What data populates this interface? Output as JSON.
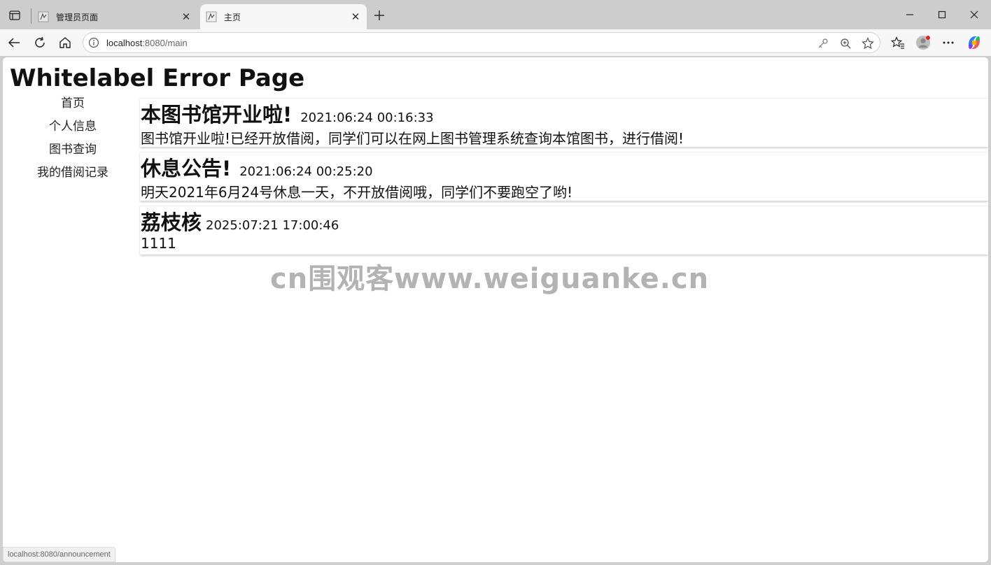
{
  "tabs": [
    {
      "title": "管理员页面",
      "active": false
    },
    {
      "title": "主页",
      "active": true
    }
  ],
  "addressbar": {
    "host": "localhost",
    "path": ":8080/main"
  },
  "page": {
    "heading": "Whitelabel Error Page"
  },
  "nav": {
    "items": [
      "首页",
      "个人信息",
      "图书查询",
      "我的借阅记录"
    ]
  },
  "notices": [
    {
      "title": "本图书馆开业啦!",
      "time": "2021:06:24 00:16:33",
      "body": "图书馆开业啦!已经开放借阅，同学们可以在网上图书管理系统查询本馆图书，进行借阅!"
    },
    {
      "title": "休息公告!",
      "time": "2021:06:24 00:25:20",
      "body": "明天2021年6月24号休息一天，不开放借阅哦，同学们不要跑空了哟!"
    },
    {
      "title": "荔枝核",
      "time": "2025:07:21 17:00:46",
      "body": "1111"
    }
  ],
  "watermark": "cn围观客www.weiguanke.cn",
  "status_url": "localhost:8080/announcement"
}
